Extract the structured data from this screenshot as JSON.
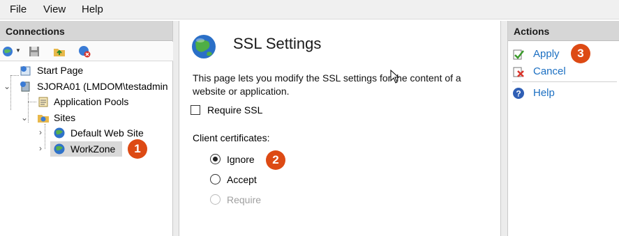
{
  "menu": {
    "file": "File",
    "view": "View",
    "help": "Help"
  },
  "connections": {
    "header": "Connections",
    "tree": {
      "start_page": "Start Page",
      "server": "SJORA01 (LMDOM\\testadmin",
      "app_pools": "Application Pools",
      "sites": "Sites",
      "default_site": "Default Web Site",
      "workzone": "WorkZone"
    }
  },
  "ssl": {
    "title": "SSL Settings",
    "description": "This page lets you modify the SSL settings for the content of a website or application.",
    "require_ssl_label": "Require SSL",
    "require_ssl_checked": false,
    "client_certs_label": "Client certificates:",
    "options": {
      "ignore": "Ignore",
      "accept": "Accept",
      "require": "Require"
    },
    "selected_option": "Ignore"
  },
  "actions": {
    "header": "Actions",
    "apply": "Apply",
    "cancel": "Cancel",
    "help": "Help"
  },
  "callouts": {
    "one": "1",
    "two": "2",
    "three": "3"
  },
  "colors": {
    "accent_link": "#1b6fc2",
    "callout": "#dd4a14",
    "header_bg": "#d6d6d6"
  },
  "icons": [
    "globe-back-icon",
    "save-icon",
    "folder-up-icon",
    "disconnect-icon",
    "start-page-icon",
    "server-icon",
    "app-pools-icon",
    "sites-folder-icon",
    "site-globe-icon",
    "apply-check-icon",
    "cancel-x-icon",
    "help-icon",
    "ssl-globe-icon"
  ]
}
